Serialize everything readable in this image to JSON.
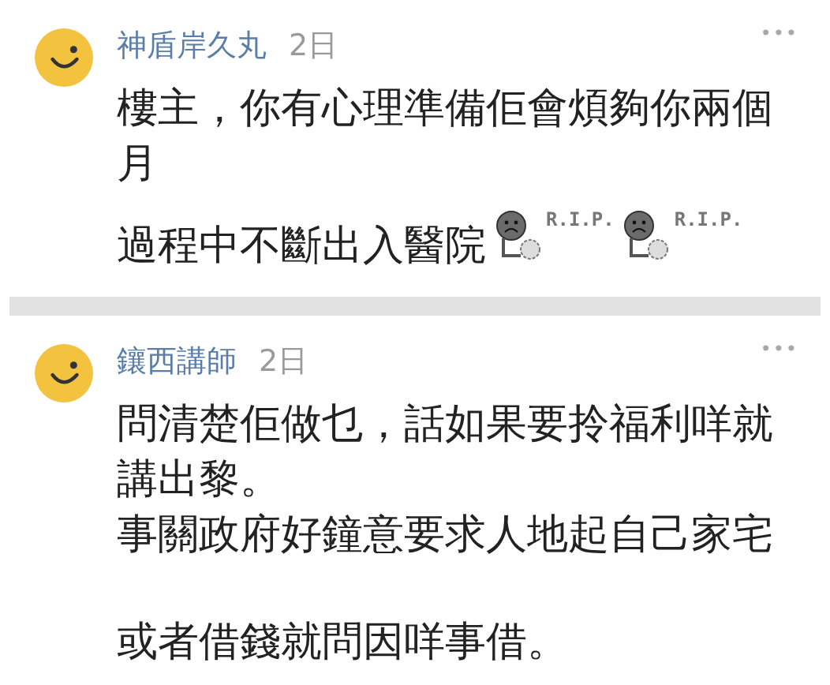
{
  "comments": [
    {
      "author": "神盾岸久丸",
      "time": "2日",
      "more": "•••",
      "paragraphs": [
        {
          "text": "樓主，你有心理準備佢會煩夠你兩個月",
          "spaced_before": false
        },
        {
          "text": "過程中不斷出入醫院",
          "spaced_before": false,
          "emoticons": [
            {
              "caption": "R.I.P."
            },
            {
              "caption": "R.I.P."
            }
          ]
        }
      ]
    },
    {
      "author": "鑲西講師",
      "time": "2日",
      "more": "•••",
      "paragraphs": [
        {
          "text": "問清楚佢做乜，話如果要拎福利咩就講出黎。",
          "spaced_before": false
        },
        {
          "text": "事關政府好鐘意要求人地起自己家宅",
          "spaced_before": false
        },
        {
          "text": "或者借錢就問因咩事借。",
          "spaced_before": true
        }
      ]
    }
  ]
}
